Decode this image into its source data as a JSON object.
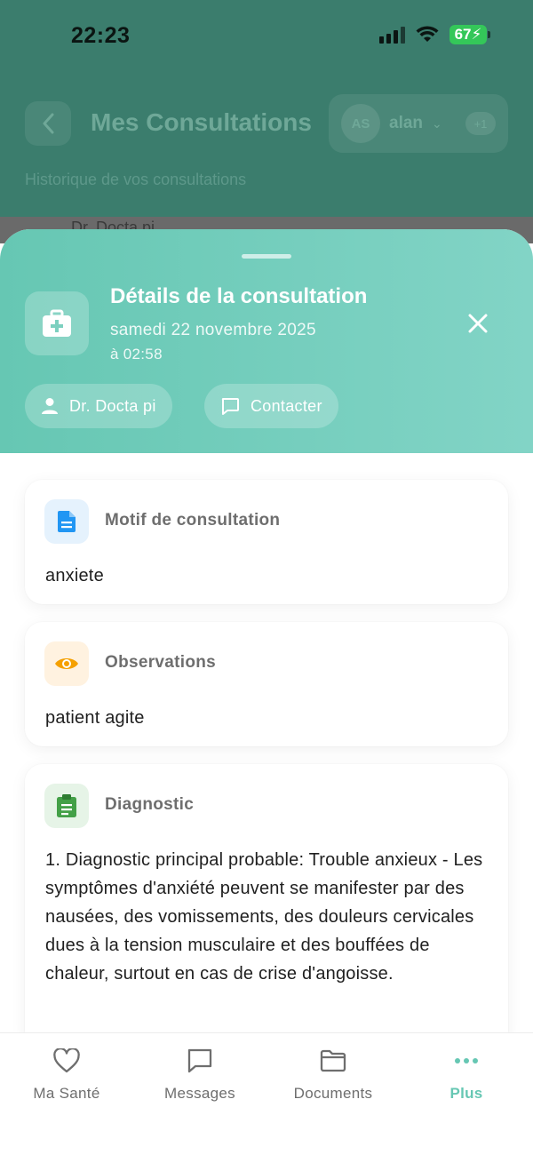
{
  "status_bar": {
    "time": "22:23",
    "battery": "67"
  },
  "background": {
    "title": "Mes Consultations",
    "subtitle": "Historique de vos consultations",
    "account": {
      "initials": "AS",
      "name": "alan",
      "extra_count": "+1"
    },
    "peek_text": "Dr. Docta pi"
  },
  "sheet": {
    "title": "Détails de la consultation",
    "date": "samedi 22 novembre 2025",
    "time": "à 02:58",
    "doctor_chip": "Dr. Docta pi",
    "contact_chip": "Contacter"
  },
  "cards": {
    "motif": {
      "title": "Motif de consultation",
      "body": "anxiete",
      "icon": "document-icon"
    },
    "observations": {
      "title": "Observations",
      "body": "patient agite",
      "icon": "eye-icon"
    },
    "diagnostic": {
      "title": "Diagnostic",
      "body": "1. Diagnostic principal probable: Trouble anxieux - Les symptômes d'anxiété peuvent se manifester par des nausées, des vomissements, des douleurs cervicales dues à la tension musculaire et des bouffées de chaleur, surtout en cas de crise d'angoisse.",
      "icon": "clipboard-icon"
    }
  },
  "bottom_nav": [
    {
      "label": "Ma Santé",
      "icon": "heart-icon"
    },
    {
      "label": "Messages",
      "icon": "chat-icon"
    },
    {
      "label": "Documents",
      "icon": "folder-icon"
    },
    {
      "label": "Plus",
      "icon": "more-icon",
      "active": true
    }
  ],
  "colors": {
    "accent": "#66c7b3",
    "overlay": "#3b7d6d",
    "motif_icon": "#2196f3",
    "observation_icon": "#f5a000",
    "diagnostic_icon": "#43a047"
  }
}
